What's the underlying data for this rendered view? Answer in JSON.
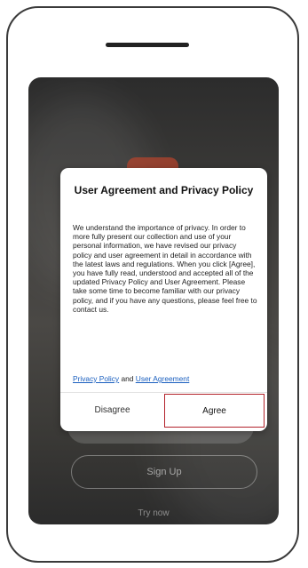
{
  "dialog": {
    "title": "User Agreement and Privacy Policy",
    "body": "We understand the importance of privacy. In order to more fully present our collection and use of your personal information, we have revised our privacy policy and user agreement in detail in accordance with the latest laws and regulations. When you click [Agree], you have fully read, understood and accepted all of the updated Privacy Policy and User Agreement. Please take some time to become familiar with our privacy policy, and if you have any questions, please feel free to contact us.",
    "privacy_link": "Privacy Policy",
    "and_text": "and",
    "user_agreement_link": "User Agreement",
    "disagree_label": "Disagree",
    "agree_label": "Agree"
  },
  "background": {
    "signup_label": "Sign Up",
    "try_label": "Try now"
  },
  "colors": {
    "agree_outline": "#b3232b",
    "link": "#1a5fbf",
    "logo": "#b1442e"
  }
}
